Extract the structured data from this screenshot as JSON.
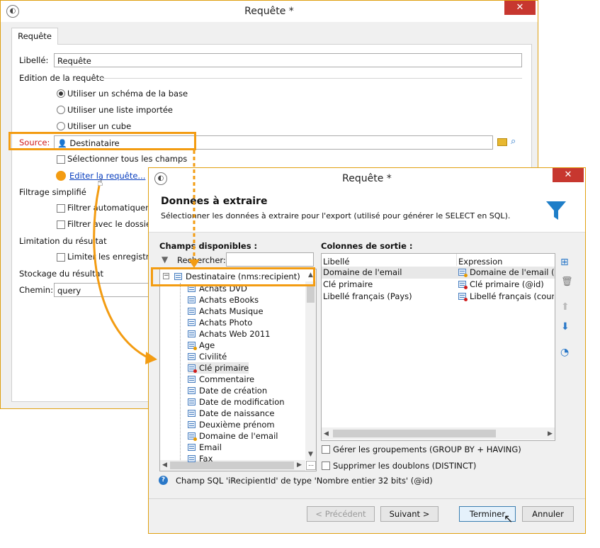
{
  "back_window": {
    "title": "Requête *",
    "tab": "Requête",
    "libelle_label": "Libellé:",
    "libelle_value": "Requête",
    "edition_header": "Edition de la requête",
    "radio_options": [
      "Utiliser un schéma de la base",
      "Utiliser une liste importée",
      "Utiliser un cube"
    ],
    "source_label": "Source:",
    "source_value": "Destinataire",
    "select_all_label": "Sélectionner tous les champs",
    "edit_link": "Editer la requête...",
    "filtrage_header": "Filtrage simplifié",
    "filter_auto": "Filtrer automatiqueme",
    "filter_folder": "Filtrer avec le dossier",
    "limit_header": "Limitation du résultat",
    "limit_check": "Limiter les enregistrer",
    "stockage_header": "Stockage du résultat",
    "chemin_label": "Chemin:",
    "chemin_value": "query"
  },
  "front_window": {
    "title": "Requête *",
    "heading": "Données à extraire",
    "subtitle": "Sélectionner les données à extraire pour l'export (utilisé pour générer le SELECT en SQL).",
    "available_label": "Champs disponibles :",
    "search_label": "Rechercher:",
    "root_node": "Destinataire (nms:recipient)",
    "tree_items": [
      "Achats DVD",
      "Achats eBooks",
      "Achats Musique",
      "Achats Photo",
      "Achats Web 2011",
      "Age",
      "Civilité",
      "Clé primaire",
      "Commentaire",
      "Date de création",
      "Date de modification",
      "Date de naissance",
      "Deuxième prénom",
      "Domaine de l'email",
      "Email",
      "Fax"
    ],
    "output_label": "Colonnes de sortie :",
    "col_headers": [
      "Libellé",
      "Expression"
    ],
    "rows": [
      {
        "label": "Domaine de l'email",
        "expr": "Domaine de l'email (@"
      },
      {
        "label": "Clé primaire",
        "expr": "Clé primaire (@id)"
      },
      {
        "label": "Libellé français (Pays)",
        "expr": "Libellé français (countr"
      }
    ],
    "group_by": "Gérer les groupements (GROUP BY + HAVING)",
    "distinct": "Supprimer les doublons (DISTINCT)",
    "info": "Champ SQL 'iRecipientId' de type 'Nombre entier 32 bits' (@id)",
    "btn_prev": "< Précédent",
    "btn_next": "Suivant >",
    "btn_finish": "Terminer",
    "btn_cancel": "Annuler"
  },
  "colors": {
    "highlight": "#f39c12",
    "close": "#c7372f",
    "funnel": "#1e7ec8",
    "source_label": "#d01a1a"
  }
}
